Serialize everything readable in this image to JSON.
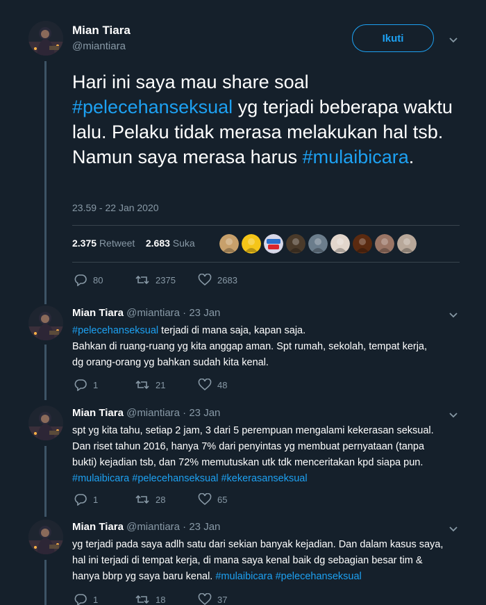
{
  "main_tweet": {
    "author_name": "Mian Tiara",
    "author_handle": "@miantiara",
    "follow_label": "Ikuti",
    "text_parts": [
      {
        "t": "Hari ini saya mau share soal ",
        "tag": false
      },
      {
        "t": "#pelecehanseksual",
        "tag": true
      },
      {
        "t": " yg terjadi beberapa waktu lalu. Pelaku tidak merasa melakukan hal tsb. Namun saya merasa harus ",
        "tag": false
      },
      {
        "t": "#mulaibicara",
        "tag": true
      },
      {
        "t": ".",
        "tag": false
      }
    ],
    "timestamp": "23.59 - 22 Jan 2020",
    "retweet_count": "2.375",
    "retweet_label": "Retweet",
    "like_count": "2.683",
    "like_label": "Suka",
    "actions": {
      "replies": "80",
      "retweets": "2375",
      "likes": "2683"
    }
  },
  "likers": [
    {
      "color": "#c7a06b",
      "icon": "liker-avatar"
    },
    {
      "color": "#f5c518",
      "icon": "liker-avatar"
    },
    {
      "color": "#d8d8e8",
      "icon": "detik-hot-logo",
      "label": "detik HOT"
    },
    {
      "color": "#4a3a2a",
      "icon": "liker-avatar"
    },
    {
      "color": "#6b7d8c",
      "icon": "liker-avatar"
    },
    {
      "color": "#e2d6cc",
      "icon": "liker-avatar"
    },
    {
      "color": "#5a2a10",
      "icon": "liker-avatar"
    },
    {
      "color": "#9a7565",
      "icon": "liker-avatar"
    },
    {
      "color": "#b8a89a",
      "icon": "liker-avatar"
    }
  ],
  "replies": [
    {
      "name": "Mian Tiara",
      "meta": "@miantiara · 23 Jan",
      "lines": [
        [
          {
            "t": "#pelecehanseksual",
            "tag": true
          },
          {
            "t": " terjadi di mana saja, kapan saja.",
            "tag": false
          }
        ],
        [
          {
            "t": "Bahkan di ruang-ruang yg kita anggap aman. Spt rumah, sekolah, tempat kerja,",
            "tag": false
          }
        ],
        [
          {
            "t": "dg orang-orang yg bahkan sudah kita kenal.",
            "tag": false
          }
        ]
      ],
      "actions": {
        "replies": "1",
        "retweets": "21",
        "likes": "48"
      }
    },
    {
      "name": "Mian Tiara",
      "meta": "@miantiara · 23 Jan",
      "lines": [
        [
          {
            "t": "spt yg kita tahu, setiap 2 jam, 3 dari 5 perempuan mengalami kekerasan seksual.",
            "tag": false
          }
        ],
        [
          {
            "t": "Dan riset tahun 2016, hanya 7% dari penyintas yg membuat pernyataan (tanpa",
            "tag": false
          }
        ],
        [
          {
            "t": "bukti) kejadian tsb, dan 72% memutuskan utk tdk menceritakan kpd siapa pun.",
            "tag": false
          }
        ],
        [
          {
            "t": "#mulaibicara",
            "tag": true
          },
          {
            "t": " ",
            "tag": false
          },
          {
            "t": "#pelecehanseksual",
            "tag": true
          },
          {
            "t": " ",
            "tag": false
          },
          {
            "t": "#kekerasanseksual",
            "tag": true
          }
        ]
      ],
      "actions": {
        "replies": "1",
        "retweets": "28",
        "likes": "65"
      }
    },
    {
      "name": "Mian Tiara",
      "meta": "@miantiara · 23 Jan",
      "lines": [
        [
          {
            "t": "yg terjadi pada saya adlh satu dari sekian banyak kejadian. Dan dalam kasus saya,",
            "tag": false
          }
        ],
        [
          {
            "t": "hal ini terjadi di tempat kerja, di mana saya kenal baik dg sebagian besar tim &",
            "tag": false
          }
        ],
        [
          {
            "t": "hanya bbrp yg saya baru kenal. ",
            "tag": false
          },
          {
            "t": "#mulaibicara",
            "tag": true
          },
          {
            "t": " ",
            "tag": false
          },
          {
            "t": "#pelecehanseksual",
            "tag": true
          }
        ]
      ],
      "actions": {
        "replies": "1",
        "retweets": "18",
        "likes": "37"
      }
    }
  ],
  "colors": {
    "background": "#15202b",
    "accent": "#1da1f2",
    "muted": "#8899a6",
    "thread_line": "#3d5466"
  }
}
